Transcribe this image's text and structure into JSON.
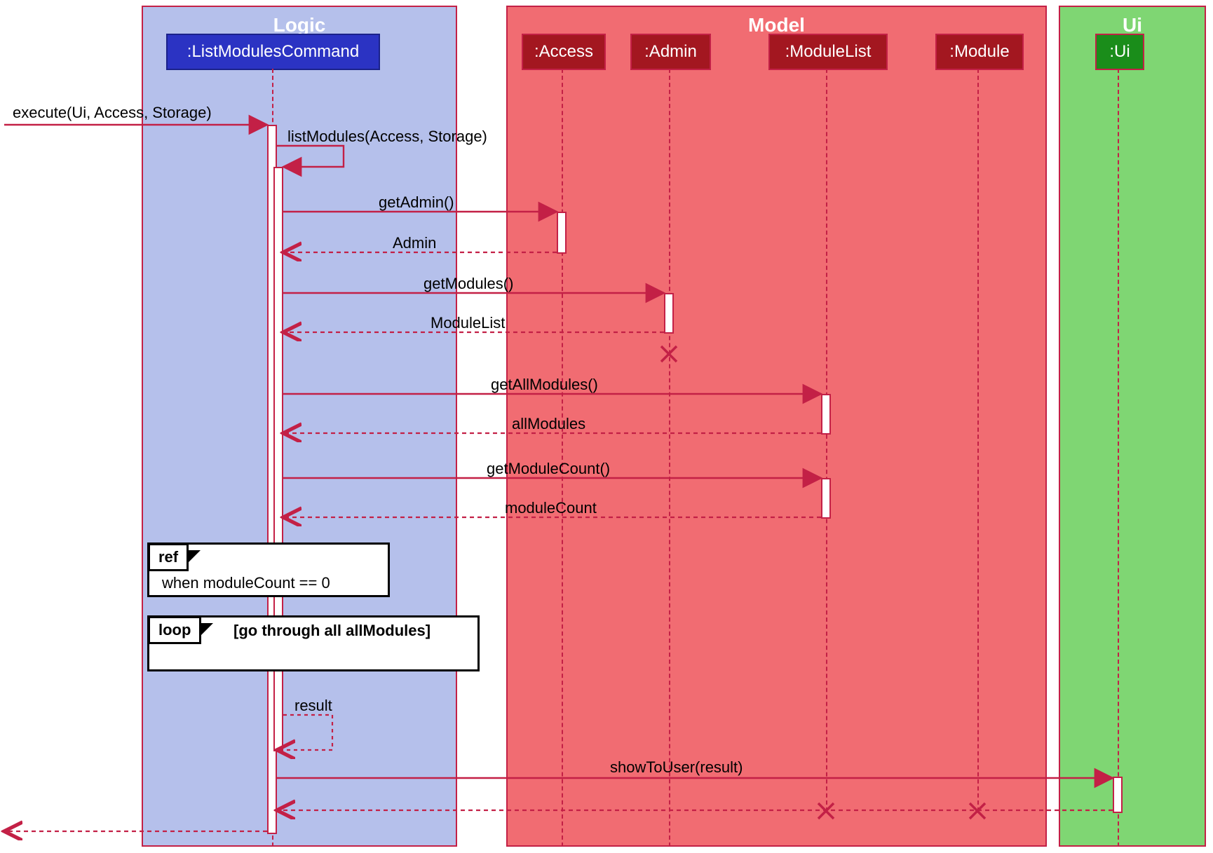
{
  "groups": {
    "logic": "Logic",
    "model": "Model",
    "ui": "Ui"
  },
  "participants": {
    "cmd": ":ListModulesCommand",
    "access": ":Access",
    "admin": ":Admin",
    "modulelist": ":ModuleList",
    "module": ":Module",
    "ui": ":Ui"
  },
  "messages": {
    "execute": "execute(Ui, Access, Storage)",
    "listModules": "listModules(Access, Storage)",
    "getAdmin": "getAdmin()",
    "retAdmin": "Admin",
    "getModules": "getModules()",
    "retModuleList": "ModuleList",
    "getAllModules": "getAllModules()",
    "retAllModules": "allModules",
    "getModuleCount": "getModuleCount()",
    "retModuleCount": "moduleCount",
    "resultReturn": "result",
    "showToUser": "showToUser(result)"
  },
  "fragments": {
    "ref": {
      "label": "ref",
      "text": "when moduleCount == 0"
    },
    "loop": {
      "label": "loop",
      "text": "[go through all allModules]"
    }
  }
}
